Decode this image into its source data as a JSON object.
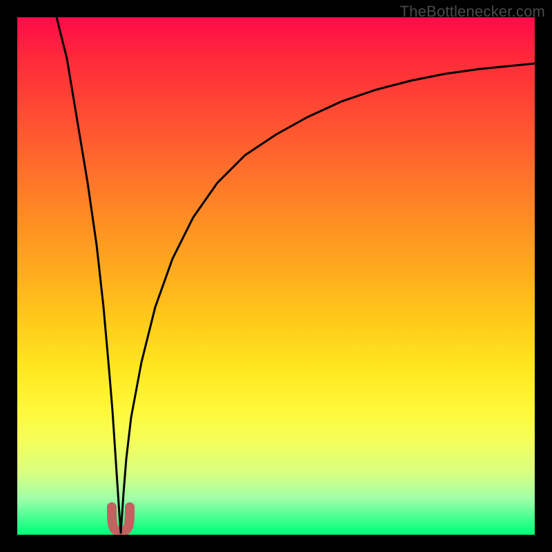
{
  "watermark": "TheBottlenecker.com",
  "chart_data": {
    "type": "line",
    "title": "",
    "xlabel": "",
    "ylabel": "",
    "xlim": [
      0,
      100
    ],
    "ylim": [
      0,
      100
    ],
    "x": [
      0,
      2,
      4,
      6,
      8,
      10,
      12,
      14,
      16,
      18,
      18.5,
      19,
      20,
      21,
      21.5,
      22,
      24,
      26,
      28,
      30,
      34,
      38,
      42,
      46,
      50,
      55,
      60,
      65,
      70,
      75,
      80,
      85,
      90,
      95,
      100
    ],
    "values": [
      100,
      88,
      77,
      67,
      57,
      47,
      38,
      29,
      20,
      9,
      5,
      2,
      0,
      2,
      5,
      9,
      22,
      33,
      42,
      49,
      59,
      66,
      71,
      75,
      78,
      81,
      83,
      85,
      86.5,
      87.7,
      88.7,
      89.5,
      90.2,
      90.7,
      91
    ],
    "notch_marker": {
      "x_range": [
        18,
        22
      ],
      "y_range": [
        0,
        5
      ],
      "color": "#c46060"
    },
    "background": "vertical heat gradient (red top to green bottom)"
  }
}
